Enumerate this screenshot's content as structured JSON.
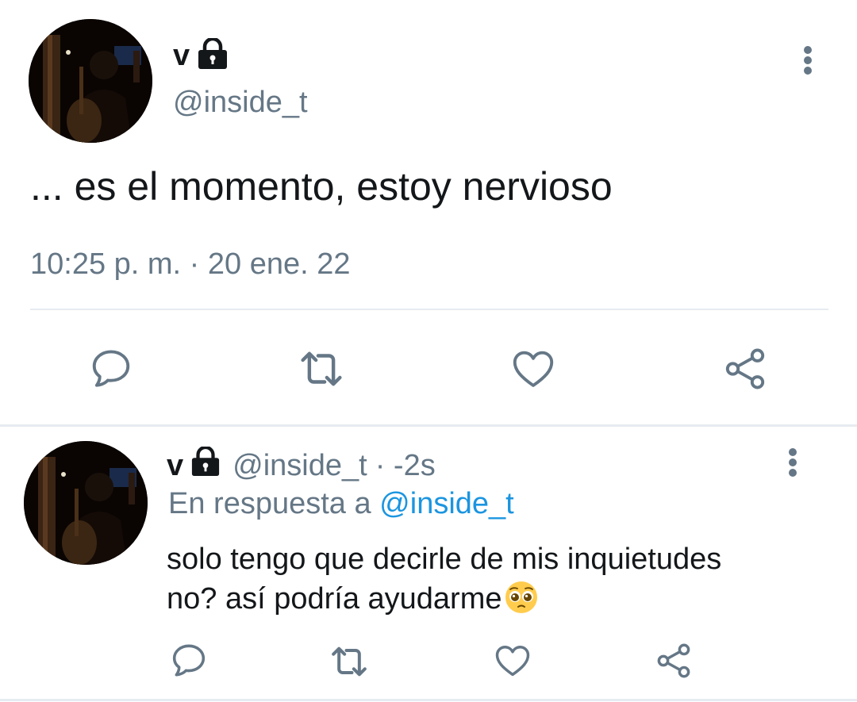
{
  "main_tweet": {
    "display_name": "v",
    "handle": "@inside_t",
    "text": "... es el momento, estoy nervioso",
    "timestamp": "10:25 p. m. · 20 ene. 22",
    "actions": [
      "reply-icon",
      "retweet-icon",
      "like-icon",
      "share-icon"
    ]
  },
  "reply_tweet": {
    "display_name": "v",
    "handle": "@inside_t",
    "time": "· -2s",
    "reply_prefix": "En respuesta a",
    "reply_to": "@inside_t",
    "text_line1": "solo tengo que decirle de mis inquietudes",
    "text_line2": "no? así podría ayudarme",
    "emoji": "pleading-face-emoji",
    "actions": [
      "reply-icon",
      "retweet-icon",
      "like-icon",
      "share-icon"
    ]
  },
  "colors": {
    "text": "#14171a",
    "secondary": "#657786",
    "link": "#1b95e0",
    "divider": "#e6ecf0"
  }
}
